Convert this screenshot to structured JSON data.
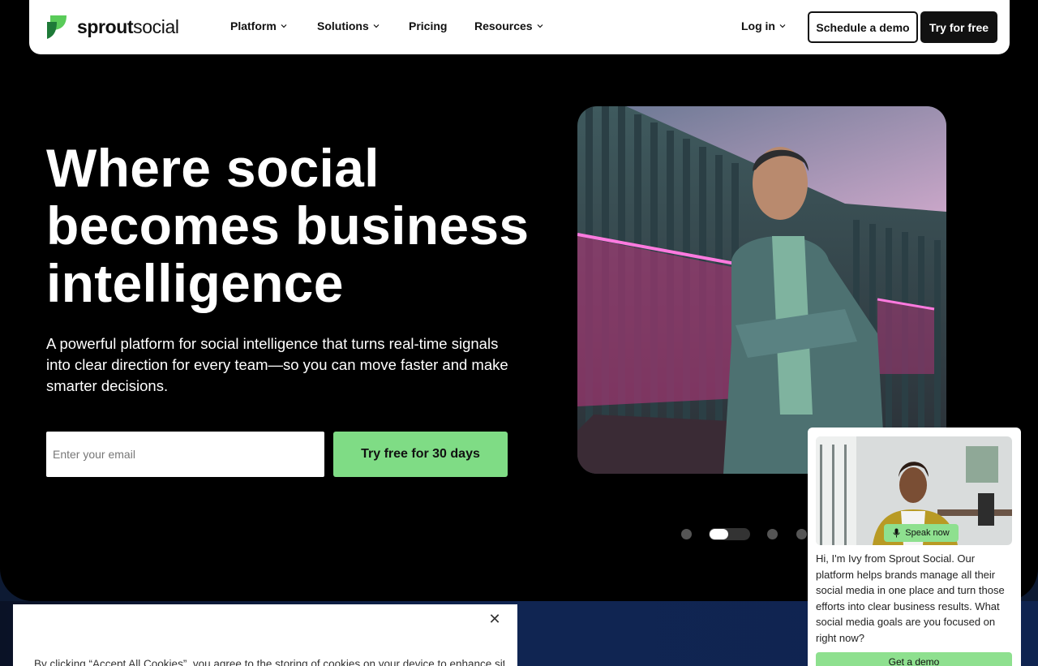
{
  "brand": {
    "name_bold": "sprout",
    "name_regular": "social",
    "colors": {
      "logo_green": "#59cb59",
      "logo_dark": "#1e7a38",
      "cta_green": "#7fdc85",
      "ink": "#111111"
    }
  },
  "nav": {
    "items": [
      {
        "label": "Platform",
        "has_dropdown": true
      },
      {
        "label": "Solutions",
        "has_dropdown": true
      },
      {
        "label": "Pricing",
        "has_dropdown": false
      },
      {
        "label": "Resources",
        "has_dropdown": true
      }
    ],
    "login_label": "Log in",
    "demo_label": "Schedule a demo",
    "trial_label": "Try for free"
  },
  "hero": {
    "headline_lines": [
      "Where social",
      "becomes business",
      "intelligence"
    ],
    "subtext": "A powerful platform for social intelligence that turns real-time signals into clear direction for every team—so you can move faster and make smarter decisions.",
    "email_placeholder": "Enter your email",
    "cta_label": "Try free for 30 days",
    "carousel": {
      "total_dots": 5,
      "active_index": 1
    }
  },
  "chat": {
    "speak_label": "Speak now",
    "message": "Hi, I'm Ivy from Sprout Social. Our platform helps brands manage all their social media in one place and turn those efforts into clear business results. What social media goals are you focused on right now?",
    "button_label": "Get a demo"
  },
  "cookie": {
    "close_symbol": "✕",
    "text": "By clicking “Accept All Cookies”, you agree to the storing of cookies on your device to enhance site"
  }
}
